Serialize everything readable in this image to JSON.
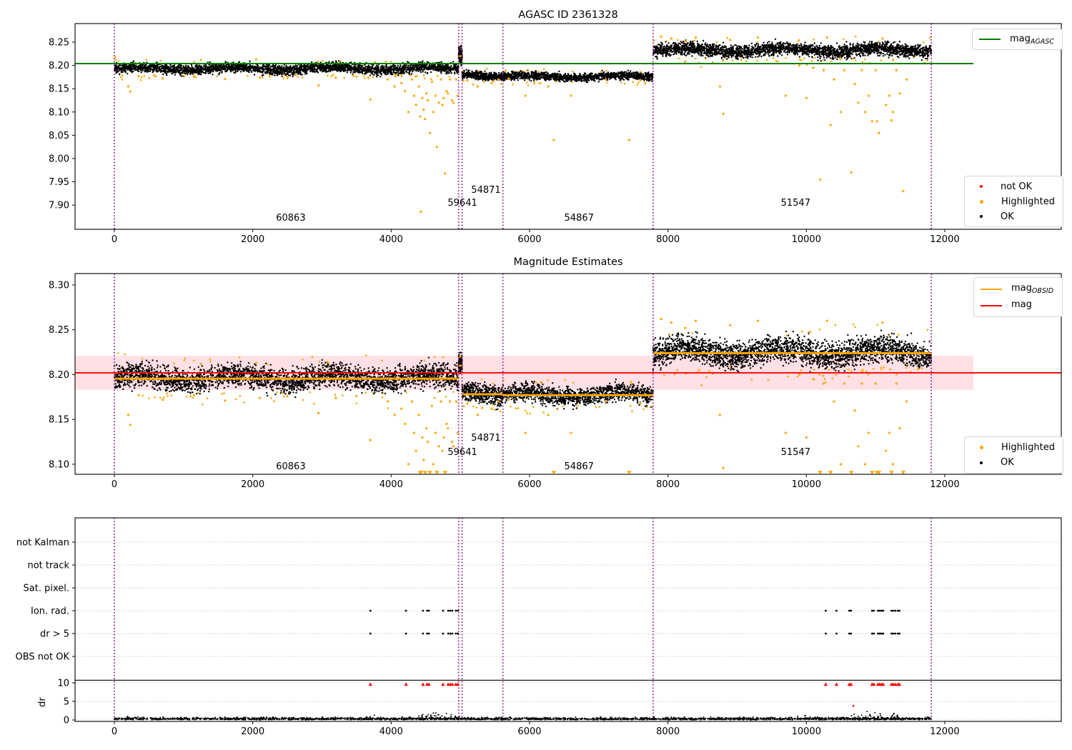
{
  "colors": {
    "ok": "#000000",
    "highlighted": "#ffa500",
    "not_ok": "#ff0000",
    "mag_agasc_line": "#008000",
    "mag_line": "#ff0000",
    "obsid_line": "#ffa500",
    "vline": "#800080",
    "band": "rgba(255,0,40,0.12)",
    "grid": "#b0b0b0"
  },
  "highlighted_outliers": [
    [
      200,
      8.155
    ],
    [
      230,
      8.144
    ],
    [
      350,
      8.177
    ],
    [
      700,
      8.172
    ],
    [
      1150,
      8.177
    ],
    [
      1250,
      8.212
    ],
    [
      1600,
      8.171
    ],
    [
      2050,
      8.213
    ],
    [
      2100,
      8.174
    ],
    [
      2500,
      8.176
    ],
    [
      2950,
      8.157
    ],
    [
      3200,
      8.174
    ],
    [
      3500,
      8.176
    ],
    [
      3700,
      8.127
    ],
    [
      3950,
      8.17
    ],
    [
      4050,
      8.155
    ],
    [
      4150,
      8.162
    ],
    [
      4200,
      8.145
    ],
    [
      4250,
      8.1
    ],
    [
      4300,
      8.17
    ],
    [
      4330,
      8.135
    ],
    [
      4360,
      8.115
    ],
    [
      4400,
      8.155
    ],
    [
      4420,
      8.09
    ],
    [
      4430,
      7.886
    ],
    [
      4450,
      8.13
    ],
    [
      4470,
      8.105
    ],
    [
      4490,
      8.085
    ],
    [
      4510,
      8.14
    ],
    [
      4530,
      8.125
    ],
    [
      4560,
      8.055
    ],
    [
      4590,
      8.165
    ],
    [
      4610,
      8.1
    ],
    [
      4640,
      8.135
    ],
    [
      4660,
      8.025
    ],
    [
      4690,
      8.12
    ],
    [
      4720,
      8.17
    ],
    [
      4740,
      8.115
    ],
    [
      4760,
      8.13
    ],
    [
      4780,
      7.968
    ],
    [
      4800,
      8.145
    ],
    [
      4820,
      8.14
    ],
    [
      4850,
      8.17
    ],
    [
      4880,
      8.125
    ],
    [
      4900,
      8.12
    ],
    [
      4940,
      8.17
    ],
    [
      4960,
      8.135
    ],
    [
      5000,
      8.22
    ],
    [
      5100,
      8.168
    ],
    [
      5250,
      8.155
    ],
    [
      5450,
      8.162
    ],
    [
      5550,
      8.17
    ],
    [
      5700,
      8.172
    ],
    [
      5940,
      8.135
    ],
    [
      6270,
      8.155
    ],
    [
      6350,
      8.04
    ],
    [
      6600,
      8.135
    ],
    [
      7100,
      8.17
    ],
    [
      7440,
      8.04
    ],
    [
      7600,
      8.168
    ],
    [
      7900,
      8.262
    ],
    [
      8050,
      8.258
    ],
    [
      8250,
      8.252
    ],
    [
      8400,
      8.26
    ],
    [
      8450,
      8.205
    ],
    [
      8750,
      8.155
    ],
    [
      8800,
      8.096
    ],
    [
      8900,
      8.255
    ],
    [
      9300,
      8.26
    ],
    [
      9700,
      8.135
    ],
    [
      9900,
      8.2
    ],
    [
      10000,
      8.13
    ],
    [
      10100,
      8.195
    ],
    [
      10200,
      7.955
    ],
    [
      10250,
      8.19
    ],
    [
      10300,
      8.26
    ],
    [
      10350,
      8.072
    ],
    [
      10400,
      8.17
    ],
    [
      10500,
      8.1
    ],
    [
      10550,
      8.19
    ],
    [
      10650,
      7.97
    ],
    [
      10700,
      8.16
    ],
    [
      10750,
      8.12
    ],
    [
      10800,
      8.19
    ],
    [
      10850,
      8.1
    ],
    [
      10900,
      8.135
    ],
    [
      10950,
      8.08
    ],
    [
      11000,
      8.19
    ],
    [
      11020,
      8.08
    ],
    [
      11050,
      8.055
    ],
    [
      11100,
      8.258
    ],
    [
      11150,
      8.115
    ],
    [
      11200,
      8.135
    ],
    [
      11230,
      8.082
    ],
    [
      11250,
      8.1
    ],
    [
      11300,
      8.19
    ],
    [
      11350,
      8.14
    ],
    [
      11400,
      7.93
    ],
    [
      11450,
      8.17
    ]
  ],
  "chart_data": [
    {
      "id": "top",
      "type": "scatter",
      "title": "AGASC ID 2361328",
      "xlim": [
        -570,
        13690
      ],
      "ylim": [
        7.848,
        8.29
      ],
      "xticks": [
        0,
        2000,
        4000,
        6000,
        8000,
        10000,
        12000
      ],
      "yticks": [
        7.9,
        7.95,
        8.0,
        8.05,
        8.1,
        8.15,
        8.2,
        8.25
      ],
      "vlines": [
        0,
        4975,
        5025,
        5615,
        7785,
        11805
      ],
      "mag_line": {
        "label_main": "mag",
        "label_sub": "AGASC",
        "value": 8.204,
        "span": [
          -570,
          12415
        ]
      },
      "segments": [
        {
          "obsid": "60863",
          "x": [
            0,
            4975
          ],
          "mean": 8.193,
          "sigma": 0.006,
          "n": 2800
        },
        {
          "obsid": "59641",
          "x": [
            4975,
            5025
          ],
          "mean": 8.2245,
          "sigma": 0.0105,
          "n": 130
        },
        {
          "obsid": "54871",
          "x": [
            5025,
            5615
          ],
          "mean": 8.1775,
          "sigma": 0.0048,
          "n": 430
        },
        {
          "obsid": "54867",
          "x": [
            5615,
            7785
          ],
          "mean": 8.176,
          "sigma": 0.0048,
          "n": 1250
        },
        {
          "obsid": "51547",
          "x": [
            7785,
            11805
          ],
          "mean": 8.233,
          "sigma": 0.008,
          "n": 2600
        }
      ],
      "obsid_labels": [
        {
          "text": "60863",
          "x": 2550,
          "y": 7.8725
        },
        {
          "text": "59641",
          "x": 5030,
          "y": 7.9045
        },
        {
          "text": "54871",
          "x": 5370,
          "y": 7.9325
        },
        {
          "text": "54867",
          "x": 6715,
          "y": 7.8725
        },
        {
          "text": "51547",
          "x": 9845,
          "y": 7.9045
        }
      ],
      "legend_points": [
        {
          "label": "not OK",
          "color_key": "not_ok"
        },
        {
          "label": "Highlighted",
          "color_key": "highlighted"
        },
        {
          "label": "OK",
          "color_key": "ok"
        }
      ]
    },
    {
      "id": "middle",
      "type": "scatter",
      "title": "Magnitude Estimates",
      "xlim": [
        -570,
        13690
      ],
      "ylim": [
        8.0888,
        8.3127
      ],
      "xticks": [
        0,
        2000,
        4000,
        6000,
        8000,
        10000,
        12000
      ],
      "yticks": [
        8.1,
        8.15,
        8.2,
        8.25,
        8.3
      ],
      "vlines": [
        0,
        4975,
        5025,
        5615,
        7785,
        11805
      ],
      "mag": {
        "label": "mag",
        "value": 8.202,
        "band": [
          8.183,
          8.221
        ],
        "band_span": [
          -570,
          12415
        ]
      },
      "legend_lines": [
        {
          "main": "mag",
          "sub": "OBSID",
          "color_key": "obsid_line"
        },
        {
          "main": "mag",
          "sub": "",
          "color_key": "mag_line"
        }
      ],
      "segments": [
        {
          "obsid": "60863",
          "x": [
            0,
            4975
          ],
          "mean": 8.196,
          "sigma": 0.0075,
          "n": 2800,
          "line": 8.1955
        },
        {
          "obsid": "59641",
          "x": [
            4975,
            5025
          ],
          "mean": 8.214,
          "sigma": 0.006,
          "n": 130,
          "line": 8.21
        },
        {
          "obsid": "54871",
          "x": [
            5025,
            5615
          ],
          "mean": 8.178,
          "sigma": 0.0058,
          "n": 430,
          "line": 8.178
        },
        {
          "obsid": "54867",
          "x": [
            5615,
            7785
          ],
          "mean": 8.1775,
          "sigma": 0.0058,
          "n": 1250,
          "line": 8.177
        },
        {
          "obsid": "51547",
          "x": [
            7785,
            11805
          ],
          "mean": 8.225,
          "sigma": 0.0085,
          "n": 2600,
          "line": 8.224
        }
      ],
      "clip_min": 8.092,
      "obsid_labels": [
        {
          "text": "60863",
          "x": 2550,
          "y": 8.0975
        },
        {
          "text": "59641",
          "x": 5030,
          "y": 8.1135
        },
        {
          "text": "54871",
          "x": 5370,
          "y": 8.1295
        },
        {
          "text": "54867",
          "x": 6715,
          "y": 8.0975
        },
        {
          "text": "51547",
          "x": 9845,
          "y": 8.1135
        }
      ],
      "legend_points": [
        {
          "label": "Highlighted",
          "color_key": "highlighted"
        },
        {
          "label": "OK",
          "color_key": "ok"
        }
      ]
    },
    {
      "id": "bottom",
      "type": "flags",
      "rows": [
        "not Kalman",
        "not track",
        "Sat. pixel.",
        "Ion. rad.",
        "dr > 5",
        "OBS not OK"
      ],
      "flag_mark_rows": [
        "Ion. rad.",
        "dr > 5"
      ],
      "dr_ticks": [
        0,
        5,
        10
      ],
      "dr_axis_label": "dr",
      "separator_dr": 10.7,
      "clipped_dr_value": 9.6,
      "xticks": [
        0,
        2000,
        4000,
        6000,
        8000,
        10000,
        12000
      ],
      "vlines": [
        0,
        4975,
        5025,
        5615,
        7785,
        11805
      ],
      "flags_x": [
        3700,
        4215,
        4460,
        4520,
        4545,
        4750,
        4825,
        4855,
        4885,
        4935,
        4965,
        10280,
        10435,
        10620,
        10645,
        10950,
        10975,
        11035,
        11060,
        11085,
        11110,
        11230,
        11255,
        11285,
        11320,
        11345
      ],
      "red_points": [
        [
          10680,
          3.8
        ]
      ],
      "baseline": {
        "n": 2600,
        "x": [
          0,
          11805
        ]
      },
      "bumps": [
        {
          "x0": 3600,
          "x1": 3760,
          "max": 1.6,
          "n": 8
        },
        {
          "x0": 4350,
          "x1": 5000,
          "max": 2.3,
          "n": 55
        },
        {
          "x0": 9700,
          "x1": 10300,
          "max": 1.5,
          "n": 15
        },
        {
          "x0": 10600,
          "x1": 11350,
          "max": 2.5,
          "n": 65
        }
      ]
    }
  ]
}
